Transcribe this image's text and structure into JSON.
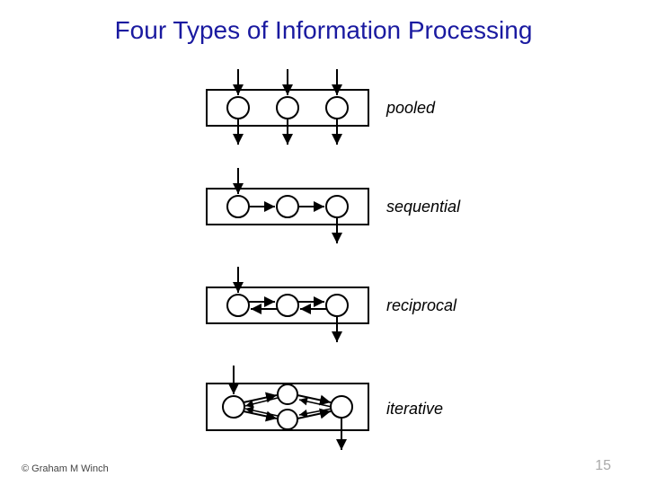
{
  "title": "Four Types of Information Processing",
  "labels": {
    "pooled": "pooled",
    "sequential": "sequential",
    "reciprocal": "reciprocal",
    "iterative": "iterative"
  },
  "footer": {
    "credit": "© Graham M Winch",
    "page": "15"
  },
  "colors": {
    "title": "#1a1aa0",
    "stroke": "#000000"
  },
  "chart_data": {
    "type": "diagram",
    "title": "Four Types of Information Processing",
    "items": [
      {
        "name": "pooled",
        "nodes": 3,
        "description": "three independent nodes, each with its own input arrow entering the box and its own output arrow exiting below",
        "inputs": [
          1,
          2,
          3
        ],
        "outputs": [
          1,
          2,
          3
        ],
        "internal_edges": []
      },
      {
        "name": "sequential",
        "nodes": 3,
        "description": "single input to first node, forward chain 1→2→3, single output from last node",
        "inputs": [
          1
        ],
        "outputs": [
          3
        ],
        "internal_edges": [
          [
            1,
            2
          ],
          [
            2,
            3
          ]
        ]
      },
      {
        "name": "reciprocal",
        "nodes": 3,
        "description": "single input to first node, bidirectional links between adjacent nodes (1↔2, 2↔3), single output from last node",
        "inputs": [
          1
        ],
        "outputs": [
          3
        ],
        "internal_edges": [
          [
            1,
            2
          ],
          [
            2,
            1
          ],
          [
            2,
            3
          ],
          [
            3,
            2
          ]
        ]
      },
      {
        "name": "iterative",
        "nodes": 4,
        "description": "single input; central cluster of two stacked nodes between outer nodes with dense cross links; single output from right node",
        "inputs": [
          1
        ],
        "outputs": [
          4
        ],
        "internal_edges": [
          [
            1,
            2
          ],
          [
            1,
            3
          ],
          [
            2,
            4
          ],
          [
            3,
            4
          ],
          [
            2,
            3
          ]
        ]
      }
    ]
  }
}
